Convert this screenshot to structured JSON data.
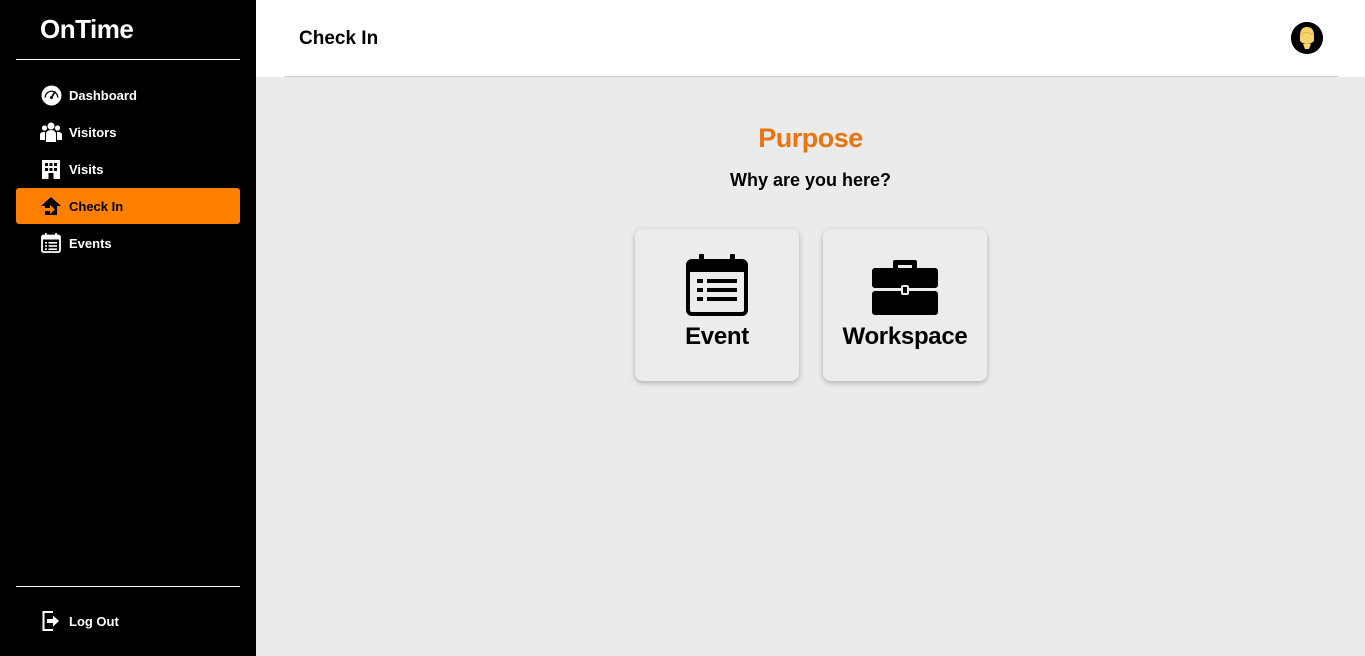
{
  "app": {
    "brand": "OnTime"
  },
  "sidebar": {
    "items": [
      {
        "label": "Dashboard",
        "icon": "dashboard-gauge-icon"
      },
      {
        "label": "Visitors",
        "icon": "users-icon"
      },
      {
        "label": "Visits",
        "icon": "building-icon"
      },
      {
        "label": "Check In",
        "icon": "check-in-arrow-icon",
        "active": true
      },
      {
        "label": "Events",
        "icon": "calendar-list-icon"
      }
    ],
    "logout": {
      "label": "Log Out",
      "icon": "logout-icon"
    }
  },
  "header": {
    "title": "Check In"
  },
  "purpose": {
    "heading": "Purpose",
    "question": "Why are you here?",
    "options": [
      {
        "label": "Event",
        "icon": "calendar-list-icon"
      },
      {
        "label": "Workspace",
        "icon": "briefcase-icon"
      }
    ]
  },
  "colors": {
    "accent": "#ff7f00",
    "heading": "#e87511",
    "sidebar": "#000000",
    "background": "#ebebeb"
  }
}
